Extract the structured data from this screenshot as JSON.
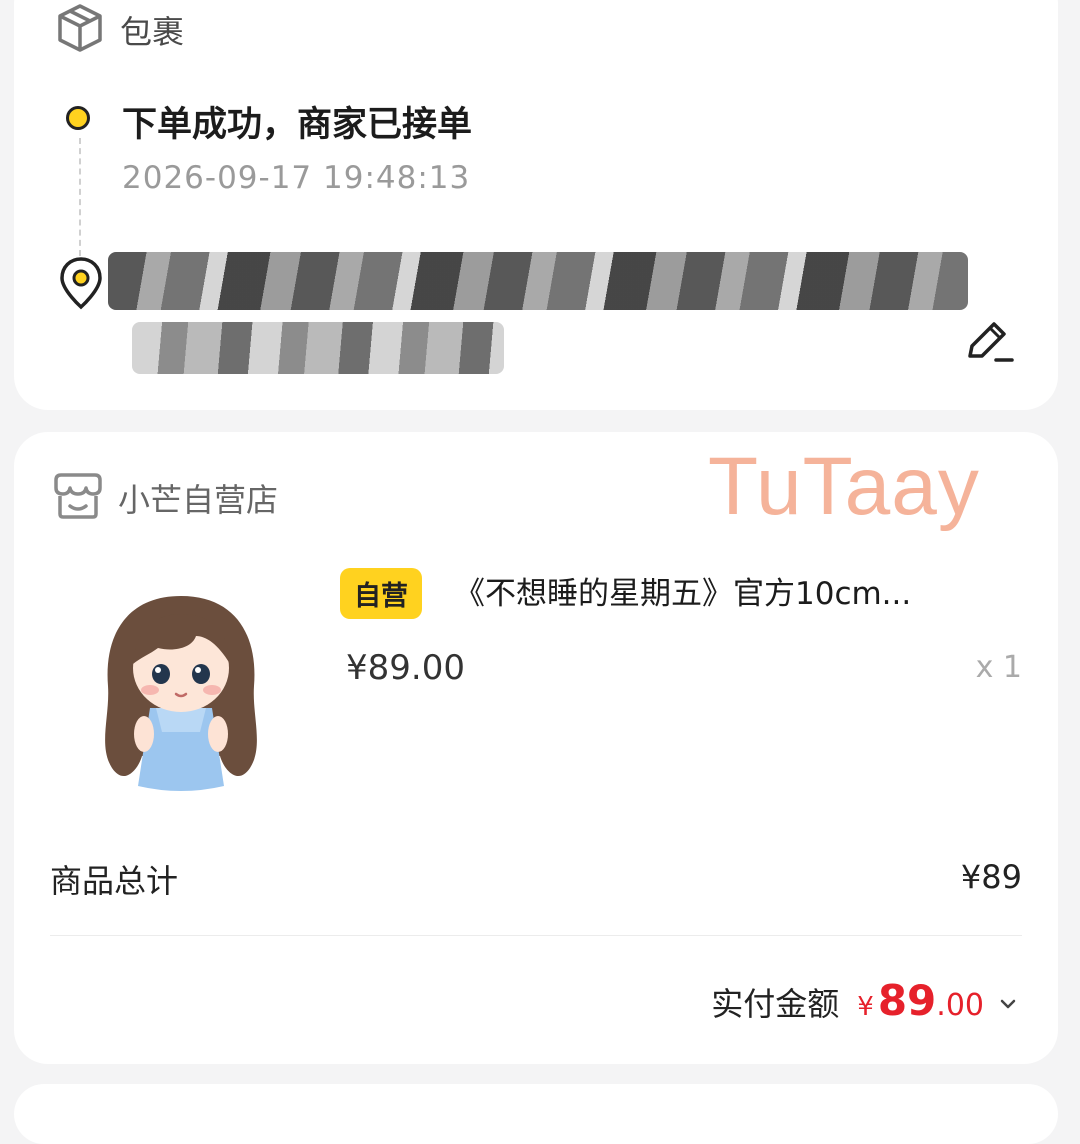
{
  "package": {
    "title": "包裹",
    "status_title": "下单成功，商家已接单",
    "status_time": "2026-09-17 19:48:13"
  },
  "shop": {
    "name": "小芒自营店",
    "watermark": "TuTaay",
    "product": {
      "badge": "自营",
      "title": "《不想睡的星期五》官方10cm...",
      "price": "¥89.00",
      "quantity": "x 1"
    },
    "subtotal": {
      "label": "商品总计",
      "value": "¥89"
    },
    "paid": {
      "label": "实付金额",
      "currency": "¥",
      "integer": "89",
      "decimal": ".00"
    }
  },
  "icons": {
    "package": "box-icon",
    "location": "location-pin-icon",
    "edit": "edit-icon",
    "store": "store-icon",
    "expand": "chevron-down-icon"
  },
  "colors": {
    "accent_yellow": "#ffd21f",
    "price_red": "#e6212b",
    "watermark": "#f5b39a"
  }
}
